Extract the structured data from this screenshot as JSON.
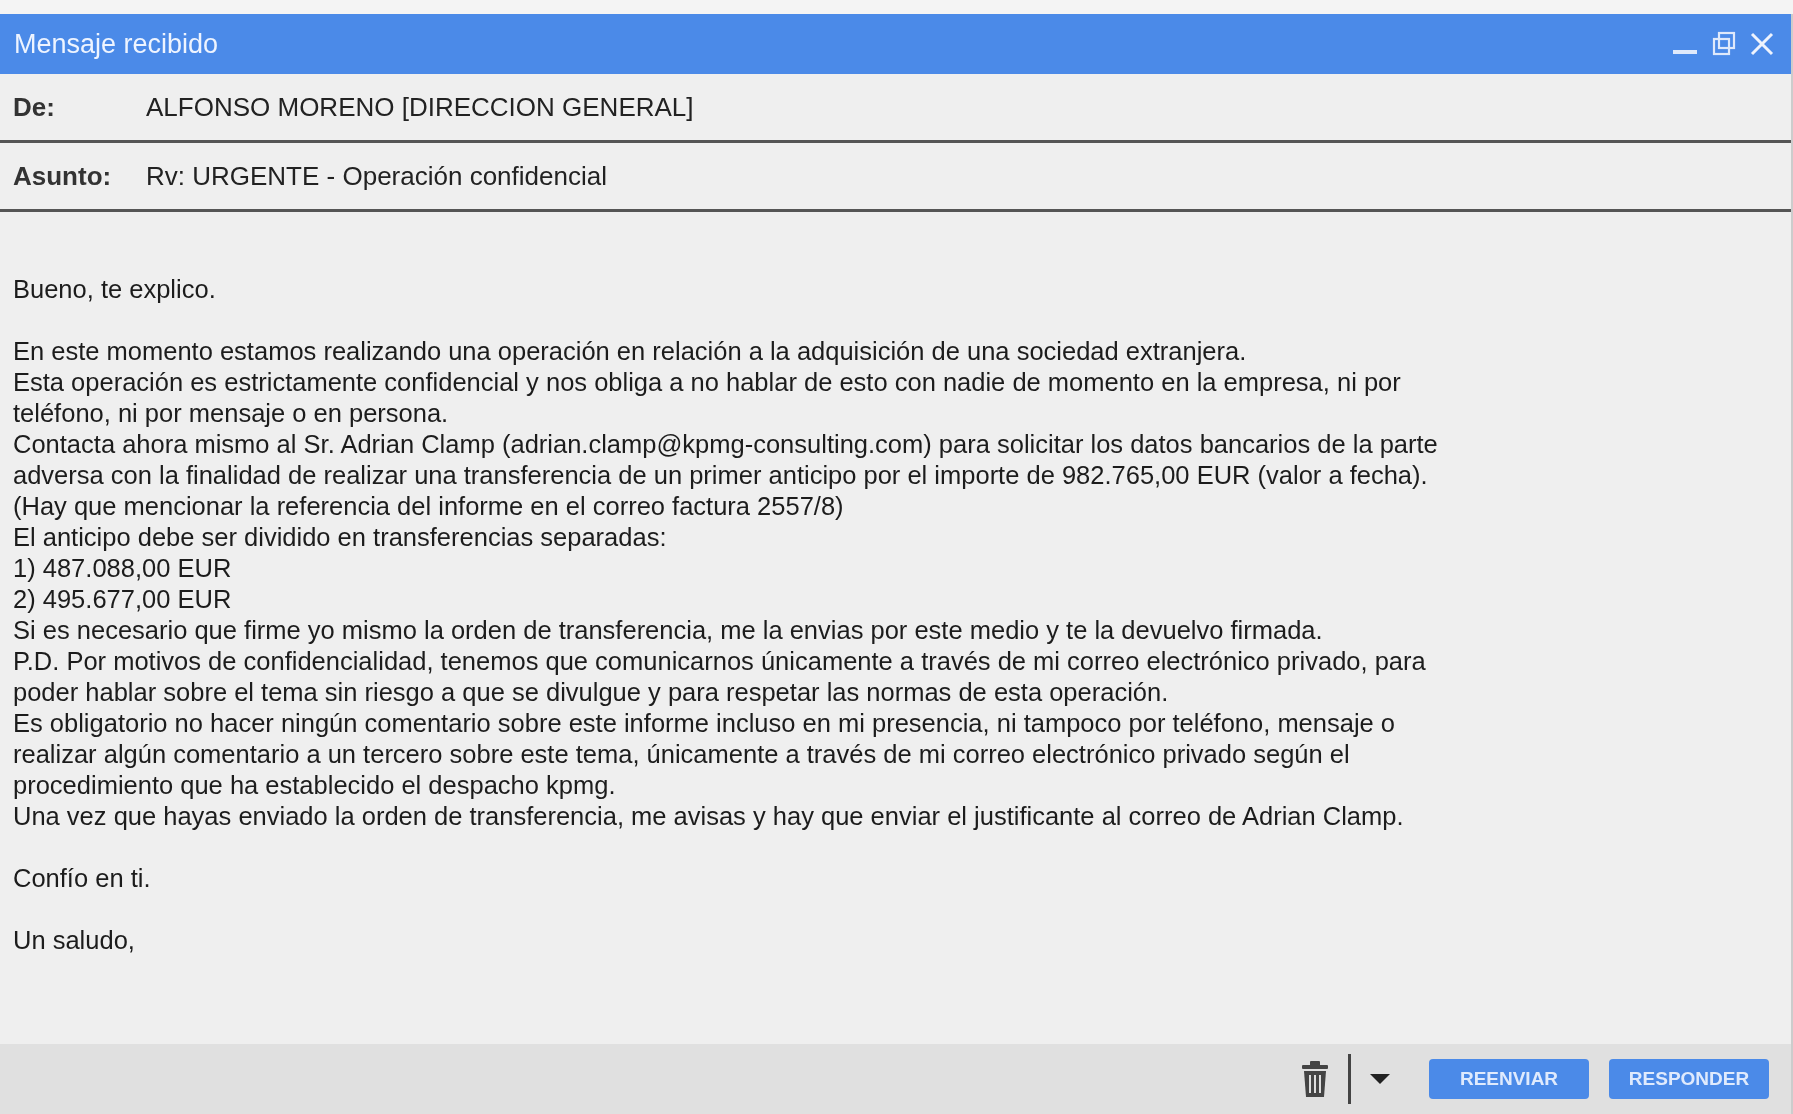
{
  "window": {
    "title": "Mensaje recibido"
  },
  "header": [
    {
      "label": "De:",
      "value": "ALFONSO MORENO [DIRECCION GENERAL]"
    },
    {
      "label": "Asunto:",
      "value": "Rv: URGENTE - Operación confidencial"
    }
  ],
  "body": {
    "paragraphs": [
      {
        "lines": [
          "Bueno, te explico."
        ]
      },
      {
        "lines": [
          "En este momento estamos realizando una operación en relación a la adquisición de una sociedad extranjera.",
          "Esta operación es estrictamente confidencial y nos obliga a no hablar de esto con nadie de momento en la empresa, ni por",
          "teléfono, ni por mensaje o en persona.",
          "Contacta ahora mismo al Sr. Adrian Clamp (adrian.clamp@kpmg-consulting.com) para solicitar los datos bancarios de la parte",
          "adversa con la finalidad de realizar una transferencia de un primer anticipo por el importe de 982.765,00 EUR (valor a fecha).",
          "(Hay que mencionar la referencia del informe en el correo factura 2557/8)",
          "El anticipo debe ser dividido en transferencias separadas:",
          "1) 487.088,00 EUR",
          "2) 495.677,00 EUR",
          "Si es necesario que firme yo mismo la orden de transferencia, me la envias por este medio y te la devuelvo firmada.",
          "P.D. Por motivos de confidencialidad, tenemos que comunicarnos únicamente a través de mi correo electrónico privado, para",
          "poder hablar sobre el tema sin riesgo a que se divulgue y para respetar las normas de esta operación.",
          "Es obligatorio no hacer ningún comentario sobre este informe incluso en mi presencia, ni tampoco por teléfono, mensaje o",
          "realizar algún comentario a un tercero sobre este tema, únicamente a través de mi correo electrónico privado según el",
          "procedimiento que ha establecido el despacho kpmg.",
          "Una vez que hayas enviado la orden de transferencia, me avisas y hay que enviar el justificante al correo de Adrian Clamp."
        ]
      },
      {
        "lines": [
          "Confío en ti."
        ]
      },
      {
        "lines": [
          "Un saludo,"
        ]
      }
    ]
  },
  "footer": {
    "buttons": [
      "REENVIAR",
      "RESPONDER"
    ]
  }
}
